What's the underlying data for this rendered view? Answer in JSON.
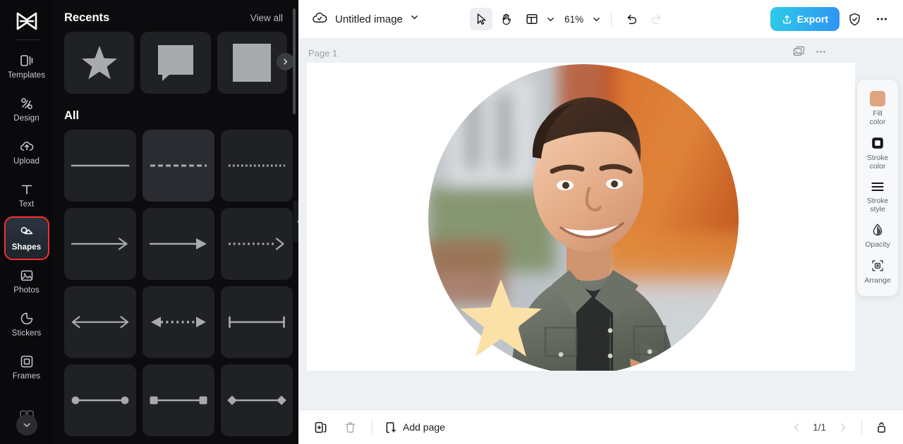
{
  "sidebar": {
    "logo_icon": "capcut-logo-icon",
    "items": [
      {
        "label": "Templates",
        "icon": "templates-icon",
        "active": false
      },
      {
        "label": "Design",
        "icon": "design-icon",
        "active": false
      },
      {
        "label": "Upload",
        "icon": "upload-cloud-icon",
        "active": false
      },
      {
        "label": "Text",
        "icon": "text-icon",
        "active": false
      },
      {
        "label": "Shapes",
        "icon": "shapes-icon",
        "active": true
      },
      {
        "label": "Photos",
        "icon": "photos-icon",
        "active": false
      },
      {
        "label": "Stickers",
        "icon": "stickers-icon",
        "active": false
      },
      {
        "label": "Frames",
        "icon": "frames-icon",
        "active": false
      }
    ],
    "expand_icon": "chevron-down-icon"
  },
  "panel": {
    "recents_title": "Recents",
    "view_all": "View all",
    "all_title": "All",
    "next_icon": "chevron-right-icon",
    "collapse_icon": "chevron-left-icon",
    "recents": [
      {
        "name": "star-shape"
      },
      {
        "name": "speech-bubble-shape"
      },
      {
        "name": "square-shape"
      }
    ],
    "shapes": [
      {
        "name": "solid-line"
      },
      {
        "name": "dashed-line"
      },
      {
        "name": "dotted-line"
      },
      {
        "name": "thin-arrow"
      },
      {
        "name": "solid-arrow"
      },
      {
        "name": "dotted-arrow"
      },
      {
        "name": "double-arrow"
      },
      {
        "name": "dotted-double-arrow"
      },
      {
        "name": "bar-ended-line"
      },
      {
        "name": "circle-ended-line"
      },
      {
        "name": "square-ended-line"
      },
      {
        "name": "diamond-ended-line"
      }
    ]
  },
  "topbar": {
    "cloud_icon": "cloud-save-icon",
    "doc_title": "Untitled image",
    "title_caret_icon": "chevron-down-icon",
    "tools": [
      {
        "name": "select-tool",
        "icon": "cursor-arrow-icon",
        "selected": true
      },
      {
        "name": "hand-tool",
        "icon": "hand-icon",
        "selected": false
      },
      {
        "name": "layout-tool",
        "icon": "layout-grid-icon",
        "selected": false
      }
    ],
    "layout_caret_icon": "chevron-down-icon",
    "zoom_level": "61%",
    "zoom_caret_icon": "chevron-down-icon",
    "undo_icon": "undo-icon",
    "redo_icon": "redo-icon",
    "export_label": "Export",
    "export_icon": "upload-share-icon",
    "shield_icon": "shield-check-icon",
    "more_icon": "more-horizontal-icon",
    "export_gradient_from": "#2ecbe8",
    "export_gradient_to": "#2f93f3"
  },
  "canvas": {
    "page_label": "Page 1",
    "page_image_icon": "image-stack-icon",
    "page_more_icon": "more-horizontal-icon",
    "selection": {
      "duplicate_icon": "duplicate-plus-icon",
      "more_icon": "more-horizontal-icon",
      "rotate_icon": "rotate-icon",
      "shape_name": "speech-bubble-shape",
      "fill_color": "#dba485",
      "handle_color": "#13c4e0"
    },
    "star_color": "#fbe0a8"
  },
  "right_tools": {
    "items": [
      {
        "label": "Fill\ncolor",
        "line1": "Fill",
        "line2": "color",
        "icon": "fill-color-swatch-icon",
        "swatch": "#e0a57f"
      },
      {
        "label": "Stroke color",
        "line1": "Stroke",
        "line2": "color",
        "icon": "stroke-color-icon"
      },
      {
        "label": "Stroke style",
        "line1": "Stroke",
        "line2": "style",
        "icon": "stroke-style-icon"
      },
      {
        "label": "Opacity",
        "line1": "Opacity",
        "line2": "",
        "icon": "opacity-drop-icon"
      },
      {
        "label": "Arrange",
        "line1": "Arrange",
        "line2": "",
        "icon": "arrange-icon"
      }
    ]
  },
  "bottombar": {
    "duplicate_page_icon": "duplicate-page-icon",
    "delete_page_icon": "trash-icon",
    "add_page_label": "Add page",
    "add_page_icon": "add-page-icon",
    "prev_icon": "chevron-left-icon",
    "next_icon": "chevron-right-icon",
    "page_count": "1/1",
    "expand_icon": "expand-panel-icon"
  }
}
